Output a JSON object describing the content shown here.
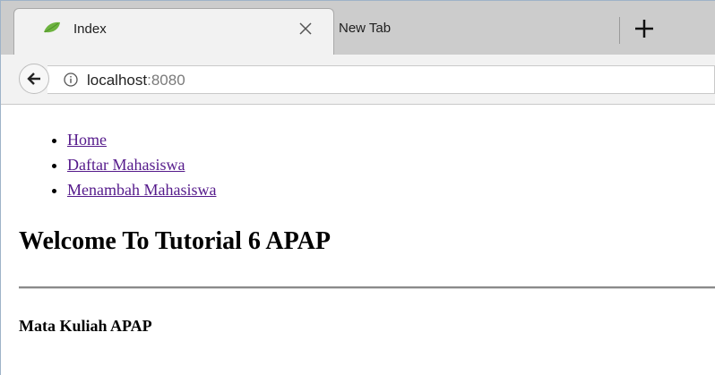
{
  "browser": {
    "tabs": [
      {
        "label": "Index",
        "active": true,
        "icon": "spring-leaf-icon"
      },
      {
        "label": "New Tab",
        "active": false
      }
    ],
    "address_bar": {
      "host": "localhost",
      "port": ":8080",
      "icon": "info-icon"
    }
  },
  "page": {
    "nav": [
      {
        "label": "Home"
      },
      {
        "label": "Daftar Mahasiswa"
      },
      {
        "label": "Menambah Mahasiswa"
      }
    ],
    "heading": "Welcome To Tutorial 6 APAP",
    "subheading": "Mata Kuliah APAP"
  },
  "colors": {
    "link_visited": "#551a8b",
    "tabstrip_bg": "#cccccc",
    "spring_green": "#6db33f"
  }
}
